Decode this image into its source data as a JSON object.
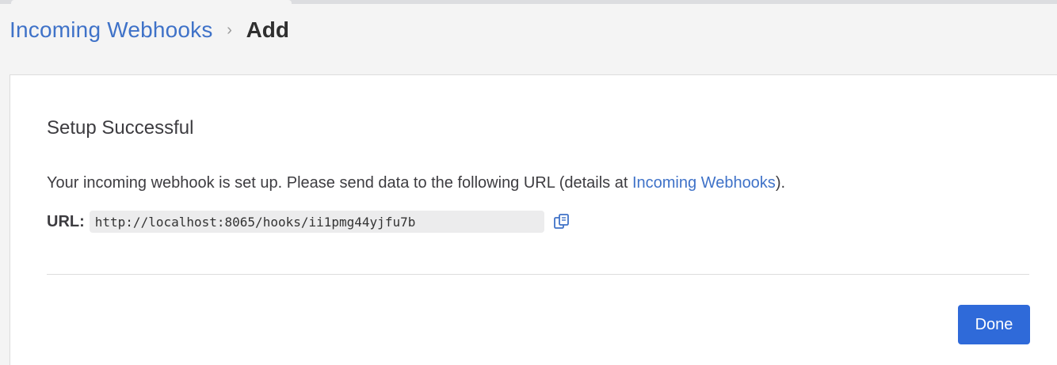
{
  "breadcrumb": {
    "parent_label": "Incoming Webhooks",
    "separator": "›",
    "current_label": "Add"
  },
  "panel": {
    "title": "Setup Successful",
    "description_prefix": "Your incoming webhook is set up. Please send data to the following URL (details at ",
    "description_link": "Incoming Webhooks",
    "description_suffix": ")."
  },
  "url_field": {
    "label": "URL:",
    "value": "http://localhost:8065/hooks/ii1pmg44yjfu7b"
  },
  "actions": {
    "done_label": "Done"
  },
  "icons": {
    "copy": "copy-icon",
    "chevron": "chevron-right-icon"
  },
  "colors": {
    "link": "#3f72c8",
    "primary_button": "#2f6ad9",
    "url_box_bg": "#ececed",
    "page_bg": "#f4f4f4"
  }
}
